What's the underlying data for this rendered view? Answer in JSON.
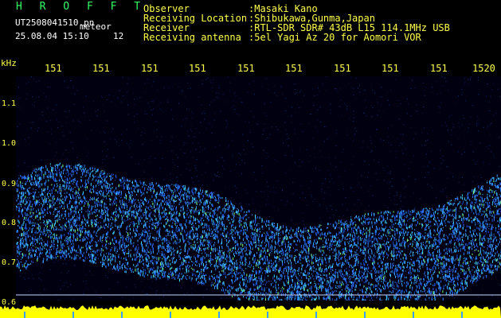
{
  "header": {
    "brand": "H R O F F T",
    "filename": "UT2508041510.pn",
    "mode": "meteor",
    "datetime": "25.08.04 15:10",
    "count": "12"
  },
  "meta": [
    {
      "label": "Observer",
      "value": ":Masaki Kano"
    },
    {
      "label": "Receiving Location",
      "value": ":Shibukawa,Gunma,Japan"
    },
    {
      "label": "Receiver",
      "value": ":RTL-SDR SDR# 43dB L15 114.1MHz USB"
    },
    {
      "label": "Receiving antenna",
      "value": ":5el Yagi Az 20 for Aomori VOR"
    }
  ],
  "axes": {
    "y_unit": "kHz",
    "y_ticks": [
      "1.1",
      "1.0",
      "0.9",
      "0.8",
      "0.7",
      "0.6"
    ],
    "x_ticks": [
      "151",
      "151",
      "151",
      "151",
      "151",
      "151",
      "151",
      "151",
      "151",
      "1520"
    ]
  },
  "colors": {
    "background": "#000000",
    "header_yellow": "#ffff4a",
    "brand_green": "#33ff66",
    "signal": "#3aa0ff",
    "band": "#ffff00"
  }
}
